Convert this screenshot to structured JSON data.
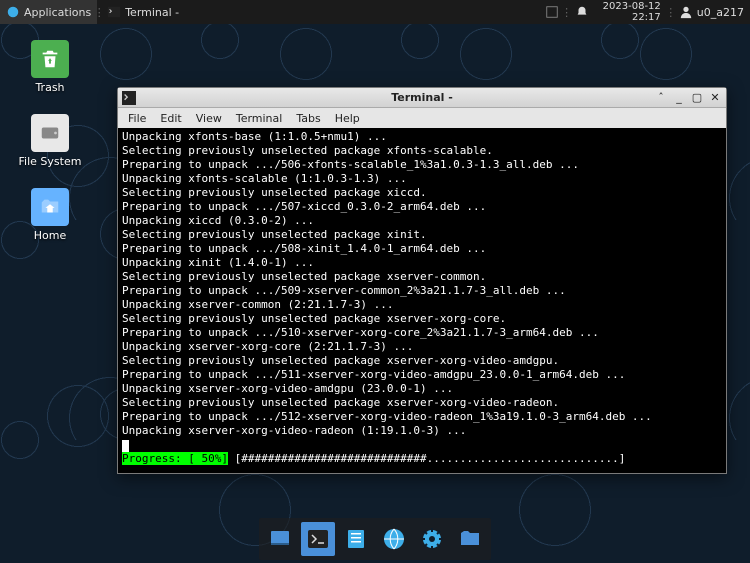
{
  "panel": {
    "apps_label": "Applications",
    "task_label": "Terminal -",
    "date": "2023-08-12",
    "time": "22:17",
    "user": "u0_a217"
  },
  "desktop": {
    "trash": "Trash",
    "filesystem": "File System",
    "home": "Home"
  },
  "window": {
    "title": "Terminal -",
    "menu": {
      "file": "File",
      "edit": "Edit",
      "view": "View",
      "terminal": "Terminal",
      "tabs": "Tabs",
      "help": "Help"
    }
  },
  "terminal": {
    "lines": [
      "Unpacking xfonts-base (1:1.0.5+nmu1) ...",
      "Selecting previously unselected package xfonts-scalable.",
      "Preparing to unpack .../506-xfonts-scalable_1%3a1.0.3-1.3_all.deb ...",
      "Unpacking xfonts-scalable (1:1.0.3-1.3) ...",
      "Selecting previously unselected package xiccd.",
      "Preparing to unpack .../507-xiccd_0.3.0-2_arm64.deb ...",
      "Unpacking xiccd (0.3.0-2) ...",
      "Selecting previously unselected package xinit.",
      "Preparing to unpack .../508-xinit_1.4.0-1_arm64.deb ...",
      "Unpacking xinit (1.4.0-1) ...",
      "Selecting previously unselected package xserver-common.",
      "Preparing to unpack .../509-xserver-common_2%3a21.1.7-3_all.deb ...",
      "Unpacking xserver-common (2:21.1.7-3) ...",
      "Selecting previously unselected package xserver-xorg-core.",
      "Preparing to unpack .../510-xserver-xorg-core_2%3a21.1.7-3_arm64.deb ...",
      "Unpacking xserver-xorg-core (2:21.1.7-3) ...",
      "Selecting previously unselected package xserver-xorg-video-amdgpu.",
      "Preparing to unpack .../511-xserver-xorg-video-amdgpu_23.0.0-1_arm64.deb ...",
      "Unpacking xserver-xorg-video-amdgpu (23.0.0-1) ...",
      "Selecting previously unselected package xserver-xorg-video-radeon.",
      "Preparing to unpack .../512-xserver-xorg-video-radeon_1%3a19.1.0-3_arm64.deb ...",
      "Unpacking xserver-xorg-video-radeon (1:19.1.0-3) ..."
    ],
    "progress_label": "Progress: [ 50%]",
    "progress_bar": " [############################.............................] "
  },
  "dock": {
    "items": [
      "show-desktop",
      "terminal",
      "files",
      "web-browser",
      "settings",
      "file-manager"
    ]
  }
}
